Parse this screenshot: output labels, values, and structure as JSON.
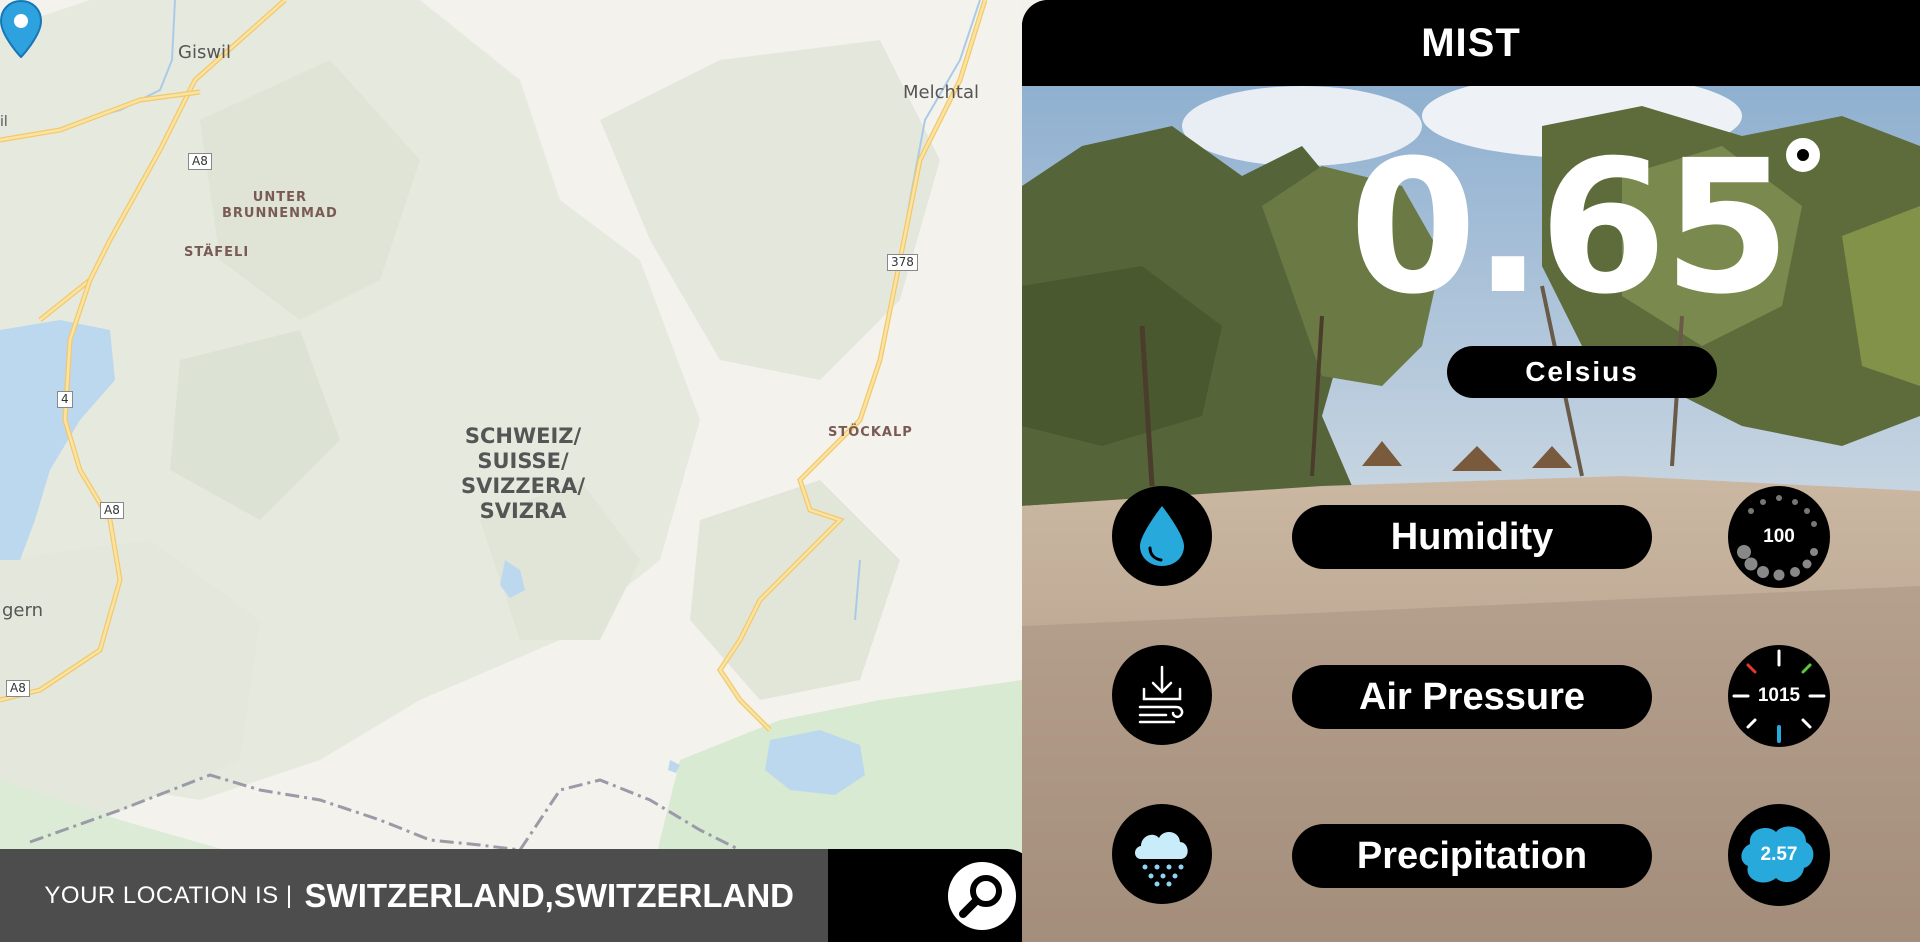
{
  "map": {
    "places": [
      "Giswil",
      "Melchtal",
      "gern",
      "il"
    ],
    "localities": [
      "UNTER\nBRUNNENMAD",
      "STÄFELI",
      "STÖCKALP"
    ],
    "road_shields": [
      "A8",
      "378",
      "4",
      "A8",
      "A8"
    ],
    "country_label": "SCHWEIZ/\nSUISSE/\nSVIZZERA/\nSVIZRA"
  },
  "location": {
    "prefix": "YOUR LOCATION IS |",
    "value": "SWITZERLAND,SWITZERLAND"
  },
  "weather": {
    "condition": "MIST",
    "temperature": "0.65",
    "unit": "Celsius",
    "rows": [
      {
        "label": "Humidity",
        "value": "100",
        "icon": "water-drop-icon"
      },
      {
        "label": "Air Pressure",
        "value": "1015",
        "icon": "wind-download-icon"
      },
      {
        "label": "Precipitation",
        "value": "2.57",
        "icon": "rain-cloud-icon"
      }
    ]
  },
  "colors": {
    "accent_blue": "#1ea1d8",
    "panel_black": "#000000",
    "location_bar": "#4d4d4d"
  }
}
